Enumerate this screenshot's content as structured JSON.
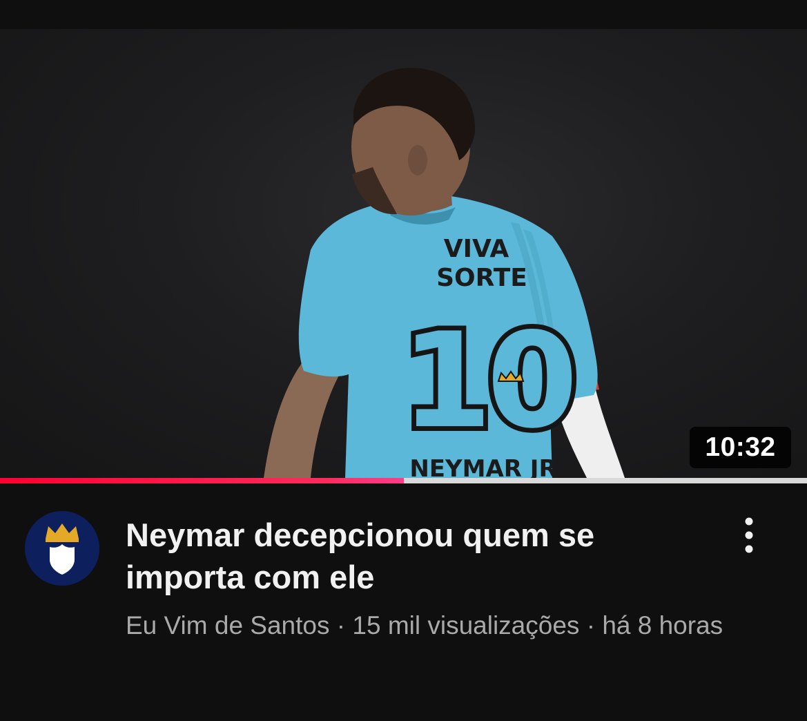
{
  "video": {
    "duration": "10:32",
    "watch_progress": 0.5,
    "title": "Neymar decepcionou quem se importa com ele",
    "channel": "Eu Vim de Santos",
    "separator": " · ",
    "views": "15 mil visualizações",
    "age": "há 8 horas"
  },
  "jersey": {
    "sponsor_line1": "VIVA",
    "sponsor_line2": "SORTE",
    "number": "10",
    "name": "NEYMAR JR"
  },
  "icons": {
    "avatar": "crown-shield-icon",
    "menu": "more-vert-icon"
  },
  "colors": {
    "background": "#0f0f0f",
    "progress": "#ff0033",
    "jersey": "#5bb8d8",
    "avatar_bg": "#0d1f5c",
    "crown": "#e5a928"
  }
}
